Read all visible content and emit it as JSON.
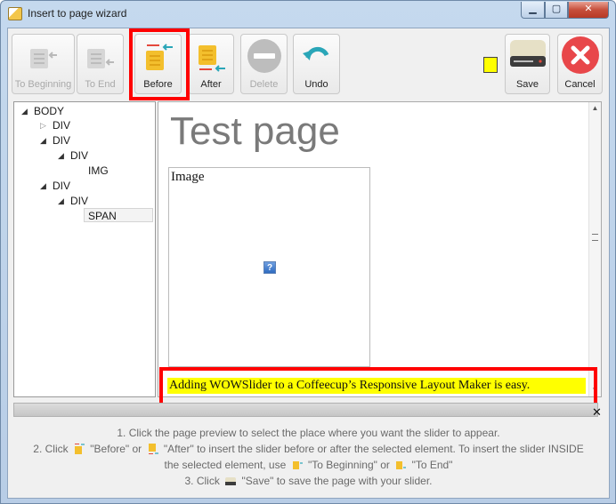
{
  "window": {
    "title": "Insert to page wizard",
    "min_glyph": "▁",
    "max_glyph": "▢",
    "close_glyph": "✕"
  },
  "toolbar": {
    "to_beginning": "To Beginning",
    "to_end": "To End",
    "before": "Before",
    "after": "After",
    "delete": "Delete",
    "undo": "Undo",
    "save": "Save",
    "cancel": "Cancel"
  },
  "tree": {
    "nodes": [
      "BODY",
      "DIV",
      "DIV",
      "DIV",
      "IMG",
      "DIV",
      "DIV",
      "SPAN"
    ]
  },
  "preview": {
    "title": "Test page",
    "image_label": "Image",
    "broken_glyph": "?",
    "span_text": "Adding WOWSlider to a  Coffeecup’s Responsive Layout Maker is easy."
  },
  "instructions": {
    "line1": "1. Click the page preview to select the place where you want the slider to appear.",
    "line2_a": "2. Click",
    "line2_b": "\"Before\" or",
    "line2_c": "\"After\" to insert the slider before or after the selected element. To insert the slider INSIDE",
    "line3_a": "the selected element, use",
    "line3_b": "\"To Beginning\" or",
    "line3_c": "\"To End\"",
    "line4_a": "3. Click",
    "line4_b": "\"Save\" to save the page with your slider."
  },
  "colors": {
    "highlight": "#ff0000",
    "span_bg": "#ffff00",
    "cancel_red": "#e8474a",
    "undo_teal": "#2aa6b8"
  },
  "icons": {
    "to_beginning": "doc-arrow-left-icon",
    "to_end": "doc-arrow-right-icon",
    "before": "doc-arrow-before-icon",
    "after": "doc-arrow-after-icon",
    "delete": "minus-circle-icon",
    "undo": "undo-arrow-icon",
    "save": "drive-icon",
    "cancel": "x-circle-icon"
  }
}
